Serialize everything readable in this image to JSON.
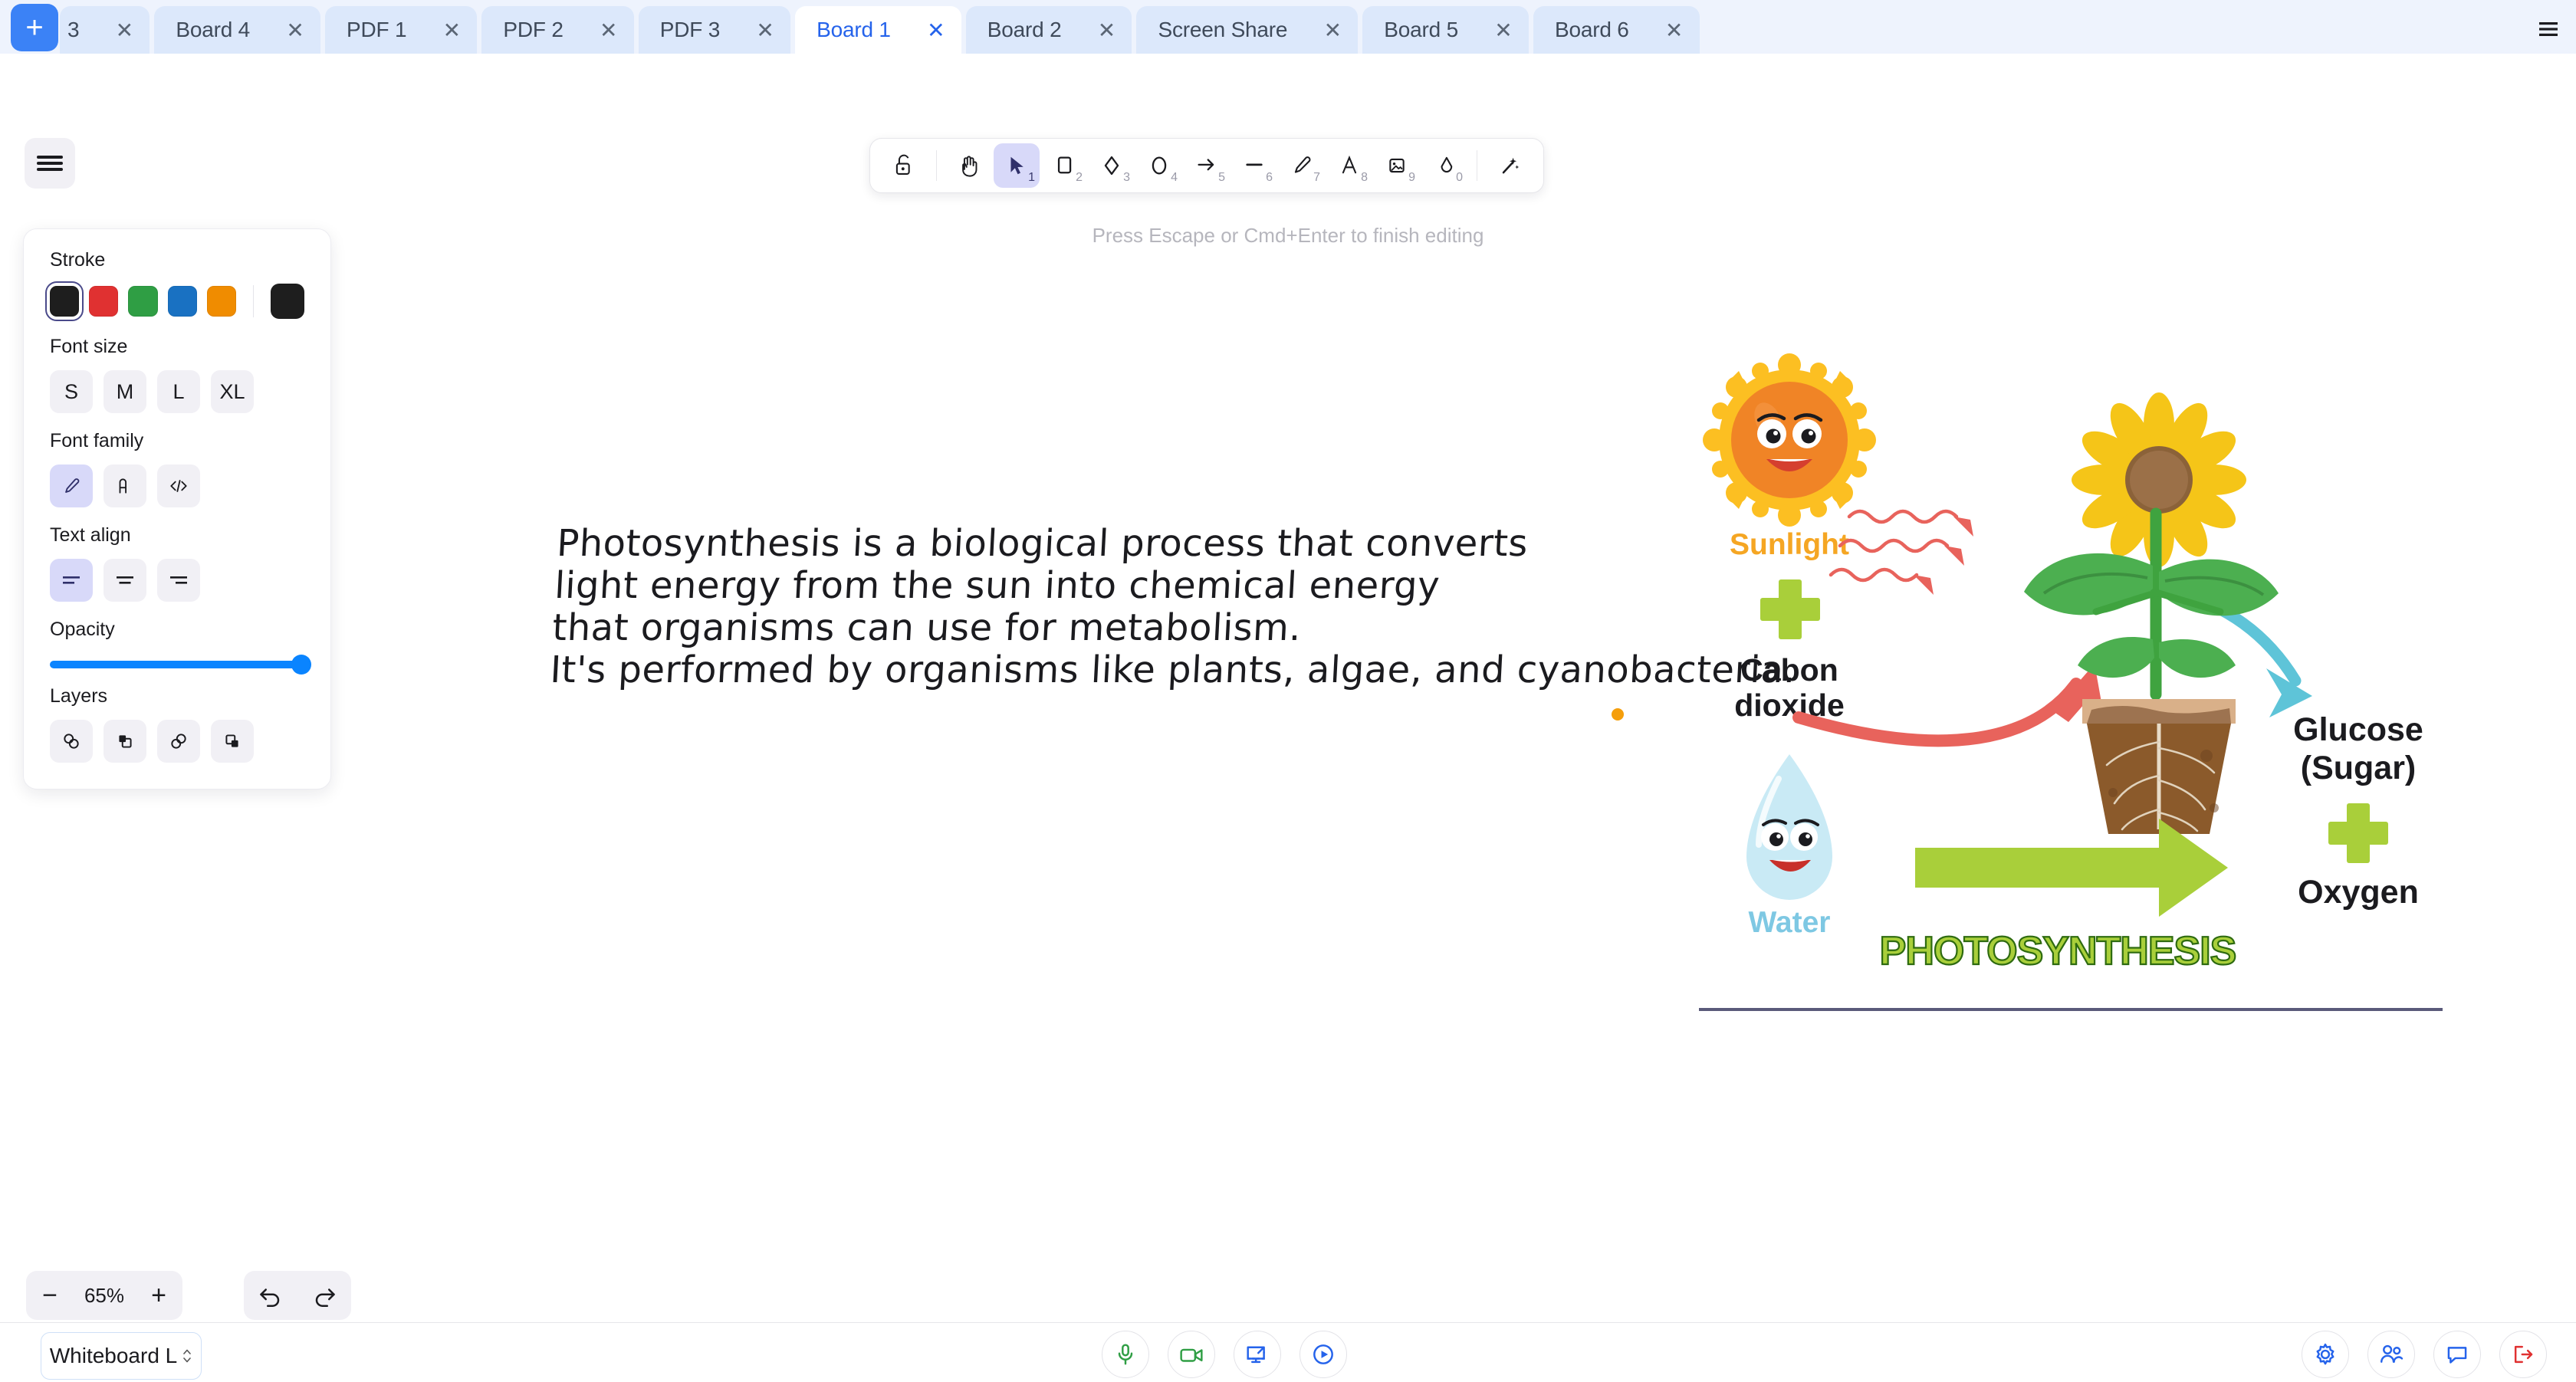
{
  "tabs": {
    "add_label": "+",
    "menu_icon": "hamburger-icon",
    "items": [
      {
        "label": "3",
        "close": "✕",
        "active": false,
        "partial": true
      },
      {
        "label": "Board 4",
        "close": "✕",
        "active": false
      },
      {
        "label": "PDF 1",
        "close": "✕",
        "active": false
      },
      {
        "label": "PDF 2",
        "close": "✕",
        "active": false
      },
      {
        "label": "PDF 3",
        "close": "✕",
        "active": false
      },
      {
        "label": "Board 1",
        "close": "✕",
        "active": true
      },
      {
        "label": "Board 2",
        "close": "✕",
        "active": false
      },
      {
        "label": "Screen Share",
        "close": "✕",
        "active": false
      },
      {
        "label": "Board 5",
        "close": "✕",
        "active": false
      },
      {
        "label": "Board 6",
        "close": "✕",
        "active": false
      }
    ]
  },
  "toolbar": {
    "tools": [
      {
        "name": "lock-icon",
        "shortcut": ""
      },
      {
        "name": "hand-icon",
        "shortcut": ""
      },
      {
        "name": "selection-icon",
        "shortcut": "1",
        "active": true
      },
      {
        "name": "rectangle-icon",
        "shortcut": "2"
      },
      {
        "name": "diamond-icon",
        "shortcut": "3"
      },
      {
        "name": "ellipse-icon",
        "shortcut": "4"
      },
      {
        "name": "arrow-icon",
        "shortcut": "5"
      },
      {
        "name": "line-icon",
        "shortcut": "6"
      },
      {
        "name": "draw-pencil-icon",
        "shortcut": "7"
      },
      {
        "name": "text-icon",
        "shortcut": "8"
      },
      {
        "name": "image-icon",
        "shortcut": "9"
      },
      {
        "name": "eraser-icon",
        "shortcut": "0"
      },
      {
        "name": "magic-wand-icon",
        "shortcut": ""
      }
    ]
  },
  "hint": "Press Escape or Cmd+Enter to finish editing",
  "panel": {
    "stroke": {
      "title": "Stroke",
      "colors": [
        "#1e1e1e",
        "#e03131",
        "#2f9e44",
        "#1971c2",
        "#f08c00"
      ],
      "selected_index": 0,
      "current": "#1e1e1e"
    },
    "font_size": {
      "title": "Font size",
      "options": [
        "S",
        "M",
        "L",
        "XL"
      ],
      "selected": ""
    },
    "font_family": {
      "title": "Font family",
      "options": [
        "hand-drawn-icon",
        "normal-text-icon",
        "code-icon"
      ],
      "selected_index": 0
    },
    "text_align": {
      "title": "Text align",
      "options": [
        "align-left-icon",
        "align-center-icon",
        "align-right-icon"
      ],
      "selected_index": 0
    },
    "opacity": {
      "title": "Opacity",
      "value": 100
    },
    "layers": {
      "title": "Layers",
      "options": [
        "send-to-back-icon",
        "send-backward-icon",
        "bring-forward-icon",
        "bring-to-front-icon"
      ]
    }
  },
  "canvas": {
    "handwritten_text": "Photosynthesis is a biological process that converts\nlight energy from the sun into chemical energy\nthat organisms can use for metabolism.\nIt's performed by organisms like plants, algae, and cyanobacteria.",
    "selection_dot_color": "#f59e0b"
  },
  "diagram": {
    "title": "PHOTOSYNTHESIS",
    "labels": {
      "sunlight": "Sunlight",
      "plus1": "+",
      "carbon_dioxide_line1": "Cabon",
      "carbon_dioxide_line2": "dioxide",
      "plus2": "+",
      "water": "Water",
      "glucose_line1": "Glucose",
      "glucose_line2": "(Sugar)",
      "plus3": "+",
      "oxygen": "Oxygen"
    },
    "colors": {
      "sun_outer": "#fcbf22",
      "sun_inner": "#f08426",
      "sunlight_text": "#f5a623",
      "water_text": "#7ec8e3",
      "water_drop": "#c9eaf5",
      "plus_green": "#a9cf3a",
      "arrow_green": "#a9cf3a",
      "arrow_red": "#e8635c",
      "arrow_blue": "#5ec4d8",
      "leaf_green": "#4caf50",
      "petal_yellow": "#f5c518",
      "pot_brown": "#8b5a2b",
      "title_green": "#4f9a20",
      "text_black": "#1b1b1f"
    }
  },
  "zoom": {
    "minus": "−",
    "value": "65%",
    "plus": "+"
  },
  "history": {
    "undo": "undo-icon",
    "redo": "redo-icon"
  },
  "bottom": {
    "whiteboard_select": "Whiteboard L",
    "media": [
      {
        "name": "microphone-icon",
        "color": "#2f9e44"
      },
      {
        "name": "camera-icon",
        "color": "#2f9e44"
      },
      {
        "name": "screen-share-icon",
        "color": "#2563eb"
      },
      {
        "name": "record-play-icon",
        "color": "#2563eb"
      }
    ],
    "right": [
      {
        "name": "settings-gear-icon",
        "color": "#2563eb"
      },
      {
        "name": "participants-icon",
        "color": "#2563eb"
      },
      {
        "name": "chat-icon",
        "color": "#2563eb"
      },
      {
        "name": "leave-call-icon",
        "color": "#e03131"
      }
    ]
  }
}
